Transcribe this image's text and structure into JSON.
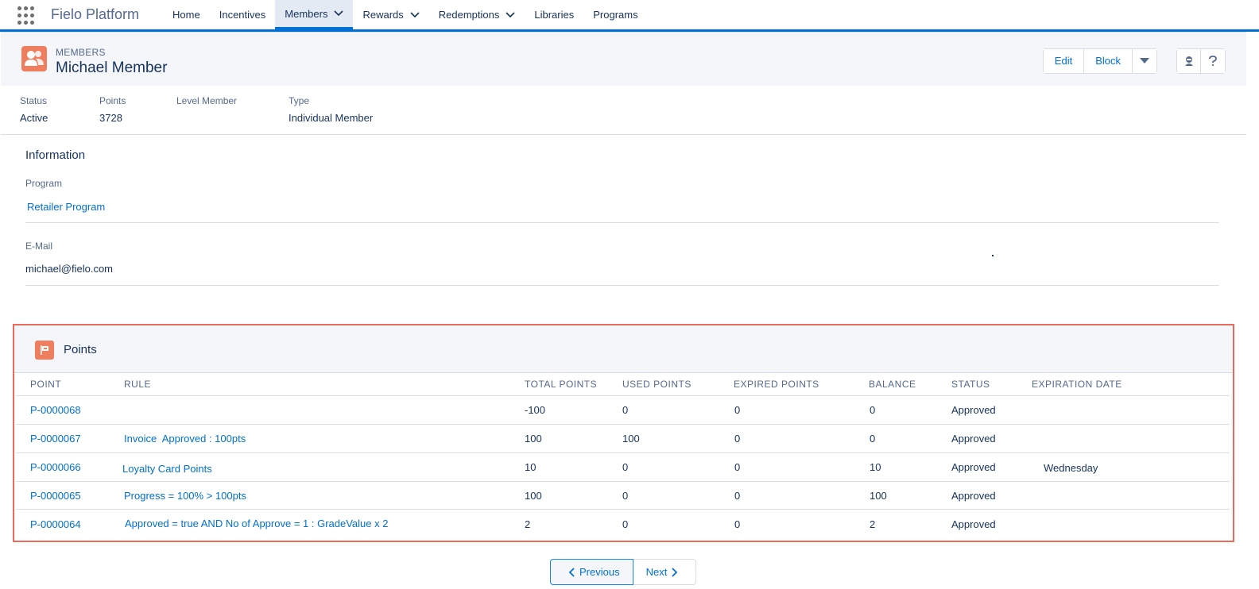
{
  "app": {
    "name": "Fielo Platform"
  },
  "nav": {
    "items": [
      {
        "label": "Home"
      },
      {
        "label": "Incentives"
      },
      {
        "label": "Members",
        "active": true,
        "dropdown": true
      },
      {
        "label": "Rewards",
        "dropdown": true
      },
      {
        "label": "Redemptions",
        "dropdown": true
      },
      {
        "label": "Libraries"
      },
      {
        "label": "Programs"
      }
    ]
  },
  "header": {
    "object_type": "MEMBERS",
    "record_name": "Michael Member",
    "actions": {
      "edit": "Edit",
      "block": "Block"
    },
    "icons": [
      "contact-icon",
      "chevron-down-icon",
      "help-icon"
    ]
  },
  "highlights": [
    {
      "label": "Status",
      "value": "Active"
    },
    {
      "label": "Points",
      "value": "3728"
    },
    {
      "label": "Level Member",
      "value": ""
    },
    {
      "label": "Type",
      "value": "Individual Member"
    }
  ],
  "information": {
    "title": "Information",
    "program_label": "Program",
    "program_value": "Retailer Program",
    "email_label": "E-Mail",
    "email_value": "michael@fielo.com"
  },
  "points": {
    "title": "Points",
    "columns": [
      "POINT",
      "RULE",
      "TOTAL POINTS",
      "USED POINTS",
      "EXPIRED POINTS",
      "BALANCE",
      "STATUS",
      "EXPIRATION DATE"
    ],
    "rows": [
      {
        "point": "P-0000068",
        "rule": "",
        "total": "-100",
        "used": "0",
        "expired": "0",
        "balance": "0",
        "status": "Approved",
        "expiration": ""
      },
      {
        "point": "P-0000067",
        "rule": "Invoice  Approved : 100pts",
        "total": "100",
        "used": "100",
        "expired": "0",
        "balance": "0",
        "status": "Approved",
        "expiration": ""
      },
      {
        "point": "P-0000066",
        "rule": "Loyalty Card Points",
        "total": "10",
        "used": "0",
        "expired": "0",
        "balance": "10",
        "status": "Approved",
        "expiration": "Wednesday"
      },
      {
        "point": "P-0000065",
        "rule": "Progress = 100% > 100pts",
        "total": "100",
        "used": "0",
        "expired": "0",
        "balance": "100",
        "status": "Approved",
        "expiration": ""
      },
      {
        "point": "P-0000064",
        "rule": "Approved = true AND No of Approve = 1 : GradeValue x 2",
        "total": "2",
        "used": "0",
        "expired": "0",
        "balance": "2",
        "status": "Approved",
        "expiration": ""
      }
    ]
  },
  "pager": {
    "previous": "Previous",
    "next": "Next"
  },
  "colors": {
    "accent": "#0070d2",
    "icon": "#ef7e5e",
    "highlight_border": "#ea6a5b"
  }
}
